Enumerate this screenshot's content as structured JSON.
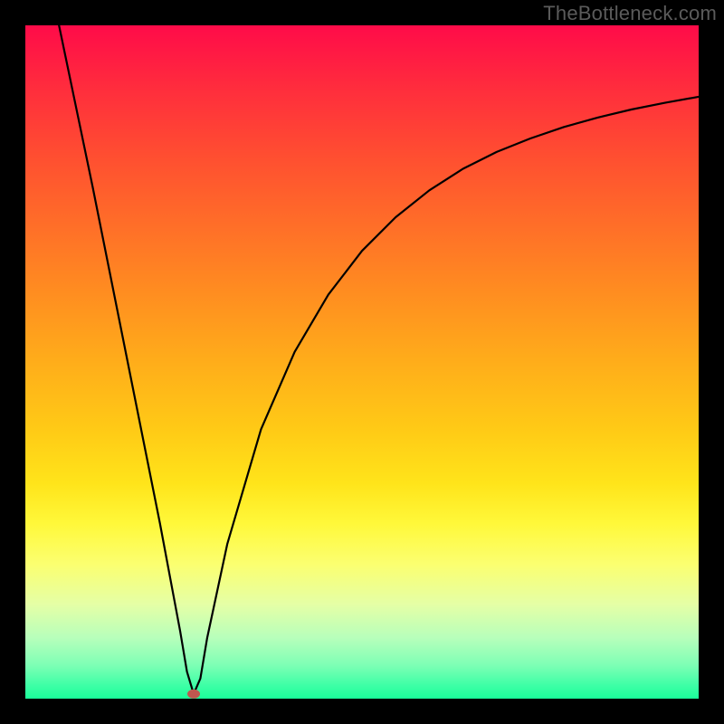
{
  "watermark": "TheBottleneck.com",
  "chart_data": {
    "type": "line",
    "title": "",
    "xlabel": "",
    "ylabel": "",
    "xlim": [
      0,
      100
    ],
    "ylim": [
      0,
      100
    ],
    "grid": false,
    "legend": false,
    "series": [
      {
        "name": "curve",
        "x": [
          5,
          10,
          15,
          20,
          23,
          24,
          25,
          26,
          27,
          30,
          35,
          40,
          45,
          50,
          55,
          60,
          65,
          70,
          75,
          80,
          85,
          90,
          95,
          100
        ],
        "y": [
          100,
          76,
          51,
          26,
          10,
          4,
          0.7,
          3,
          9,
          23,
          40,
          51.5,
          60,
          66.5,
          71.5,
          75.5,
          78.7,
          81.2,
          83.2,
          84.9,
          86.3,
          87.5,
          88.5,
          89.4
        ]
      }
    ],
    "marker": {
      "x": 25,
      "y": 0.7
    },
    "background_gradient": {
      "top": "#ff0b49",
      "mid": "#ffca16",
      "bottom": "#1aff9a"
    }
  }
}
